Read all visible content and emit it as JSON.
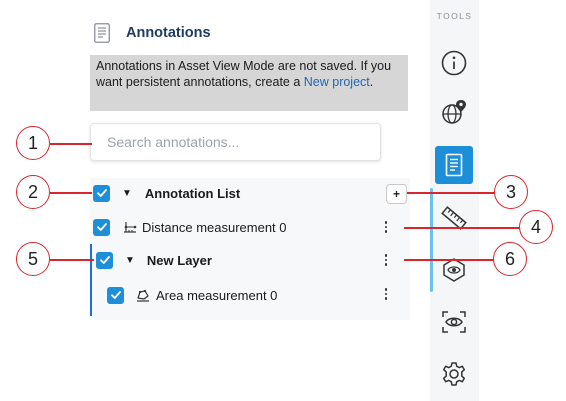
{
  "panel": {
    "title": "Annotations",
    "notice": {
      "text": "Annotations in Asset View Mode are not saved. If you want persistent annotations, create a ",
      "link": "New project",
      "suffix": "."
    },
    "search": {
      "placeholder": "Search annotations...",
      "value": ""
    }
  },
  "list": {
    "root": {
      "label": "Annotation List",
      "checked": true,
      "add_label": "+"
    },
    "items": [
      {
        "label": "Distance measurement 0",
        "icon": "distance-measurement-icon",
        "checked": true
      }
    ],
    "layer": {
      "label": "New Layer",
      "checked": true,
      "items": [
        {
          "label": "Area measurement 0",
          "icon": "area-measurement-icon",
          "checked": true
        }
      ]
    }
  },
  "toolbar": {
    "label": "TOOLS",
    "tools": [
      {
        "name": "info-icon",
        "active": false
      },
      {
        "name": "globe-pin-icon",
        "active": false
      },
      {
        "name": "annotations-icon",
        "active": true
      },
      {
        "name": "ruler-icon",
        "active": false
      },
      {
        "name": "layers-eye-icon",
        "active": false
      },
      {
        "name": "visibility-icon",
        "active": false
      },
      {
        "name": "settings-icon",
        "active": false
      }
    ]
  },
  "callouts": [
    "1",
    "2",
    "3",
    "4",
    "5",
    "6"
  ],
  "colors": {
    "accent": "#1d8fd8",
    "callout": "#d7262c",
    "notice_bg": "#d6d6d6",
    "link": "#2366b3"
  }
}
